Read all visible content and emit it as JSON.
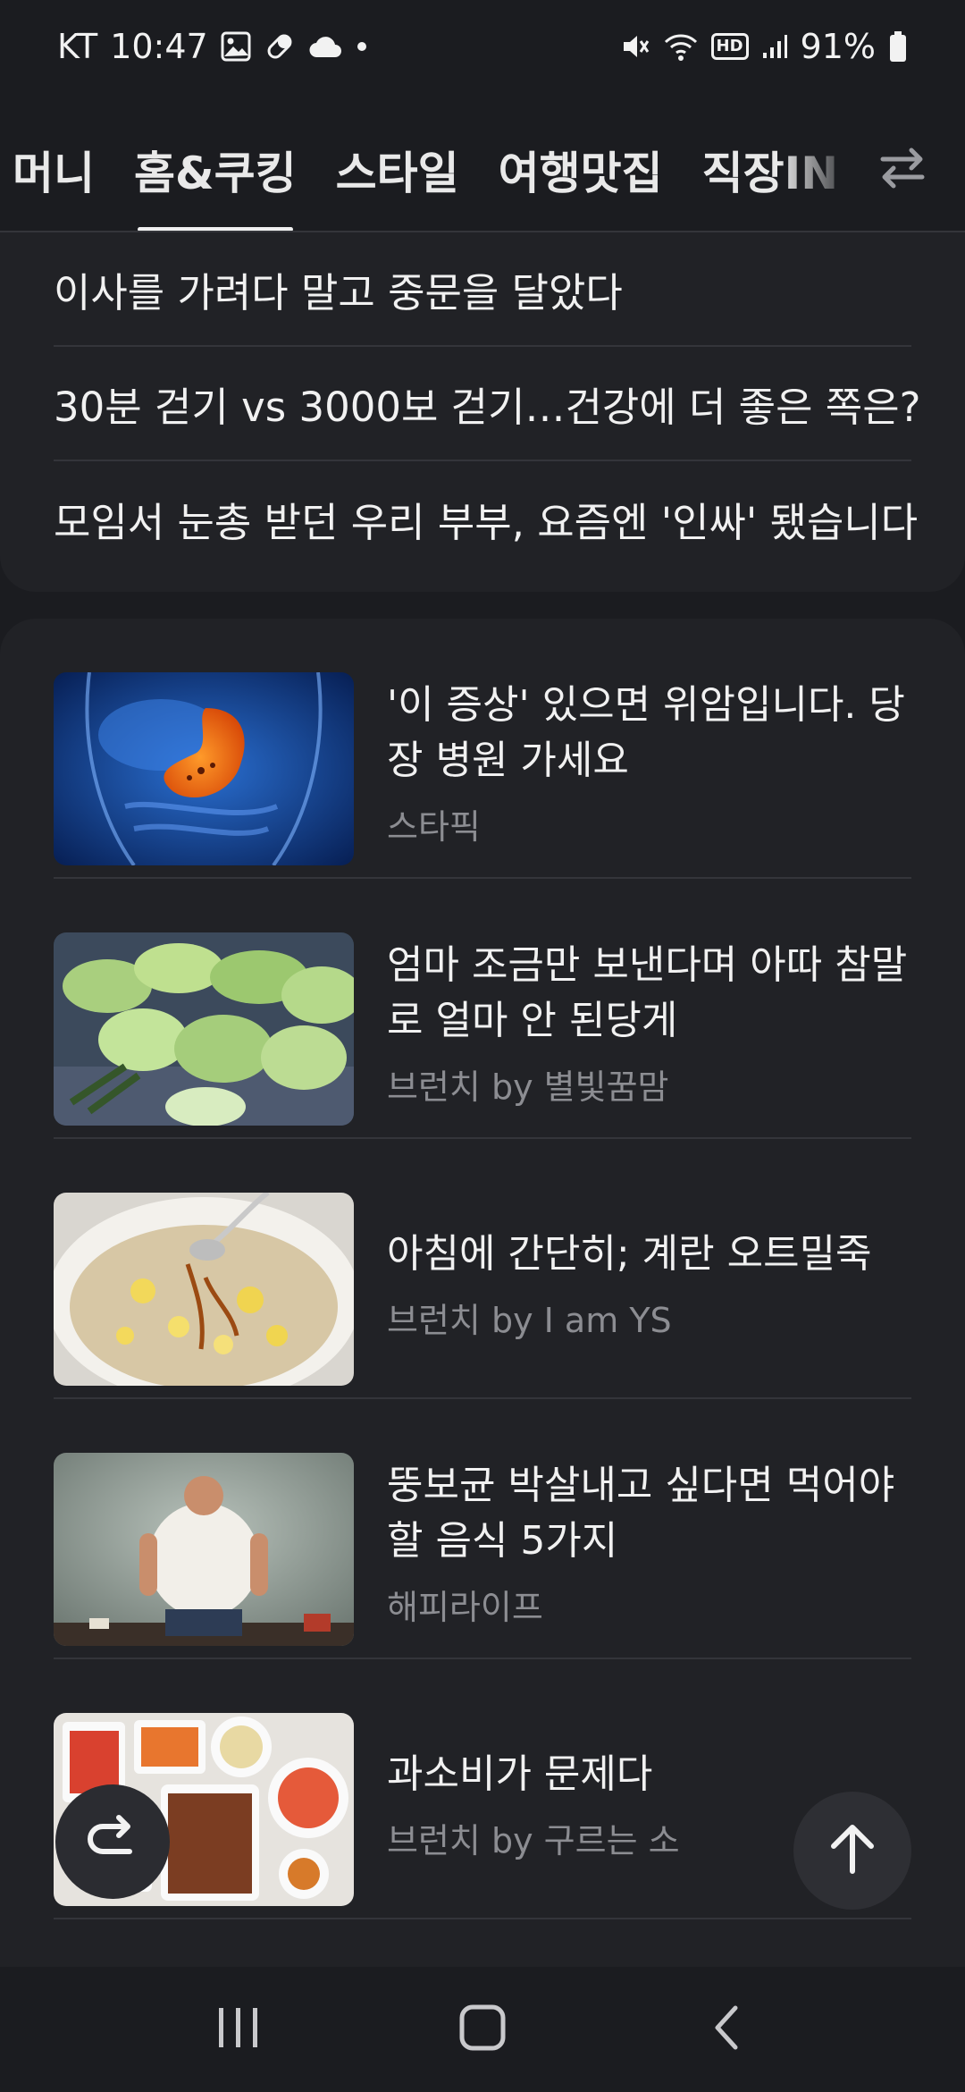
{
  "status_bar": {
    "carrier": "KT",
    "time": "10:47",
    "battery": "91%",
    "hd_label": "HD"
  },
  "tabs": [
    {
      "label": "머니",
      "active": false
    },
    {
      "label": "홈&쿠킹",
      "active": true
    },
    {
      "label": "스타일",
      "active": false
    },
    {
      "label": "여행맛집",
      "active": false
    },
    {
      "label": "직장IN",
      "active": false
    }
  ],
  "headlines": [
    "이사를 가려다 말고 중문을 달았다",
    "30분 걷기 vs 3000보 걷기…건강에 더 좋은 쪽은?",
    "모임서 눈총 받던 우리 부부, 요즘엔 '인싸' 됐습니다"
  ],
  "articles": [
    {
      "title": "'이 증상' 있으면 위암입니다. 당장 병원 가세요",
      "source": "스타픽",
      "image": "stomach-illustration"
    },
    {
      "title": "엄마 조금만 보낸다며 아따 참말로 얼마 안 된당게",
      "source": "브런치 by 별빛꿈맘",
      "image": "cabbage-photo"
    },
    {
      "title": "아침에 간단히; 계란 오트밀죽",
      "source": "브런치 by I am YS",
      "image": "oatmeal-porridge-photo"
    },
    {
      "title": "뚱보균 박살내고 싶다면 먹어야 할 음식 5가지",
      "source": "해피라이프",
      "image": "overweight-man-photo"
    },
    {
      "title": "과소비가 문제다",
      "source": "브런치 by 구르는 소",
      "image": "food-spread-photo"
    }
  ],
  "icons": {
    "share": "share-icon",
    "scroll_top": "arrow-up-icon",
    "tab_swap": "swap-arrows-icon"
  },
  "colors": {
    "background": "#1b1c20",
    "card": "#212226",
    "text_primary": "#f1f1f1",
    "text_secondary": "#8c8d92"
  }
}
